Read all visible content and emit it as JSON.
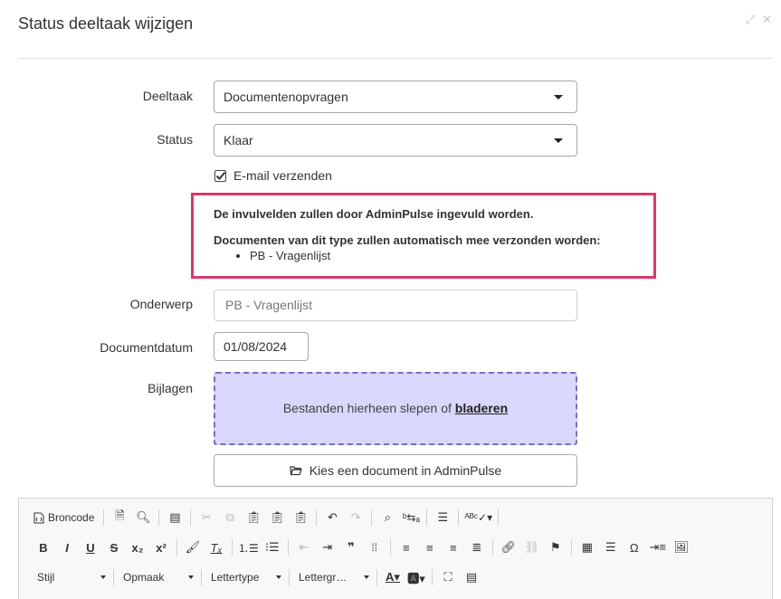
{
  "dialog": {
    "title": "Status deeltaak wijzigen"
  },
  "form": {
    "deeltaak_label": "Deeltaak",
    "deeltaak_value": "Documentenopvragen",
    "status_label": "Status",
    "status_value": "Klaar",
    "email_label": "E-mail verzenden",
    "info_line1": "De invulvelden zullen door AdminPulse ingevuld worden.",
    "info_line2": "Documenten van dit type zullen automatisch mee verzonden worden:",
    "info_item": "PB - Vragenlijst",
    "onderwerp_label": "Onderwerp",
    "onderwerp_placeholder": "PB - Vragenlijst",
    "documentdatum_label": "Documentdatum",
    "documentdatum_value": "01/08/2024",
    "bijlagen_label": "Bijlagen",
    "dropzone_text": "Bestanden hierheen slepen of ",
    "dropzone_link": "bladeren",
    "choose_doc_button": "Kies een document in AdminPulse"
  },
  "editor": {
    "source_label": "Broncode",
    "combo_style": "Stijl",
    "combo_format": "Opmaak",
    "combo_font": "Lettertype",
    "combo_size": "Lettergr…"
  },
  "colors": {
    "accent_border": "#d9386a",
    "dropzone_bg": "#d9d7fb",
    "dropzone_border": "#7a6fbb"
  }
}
